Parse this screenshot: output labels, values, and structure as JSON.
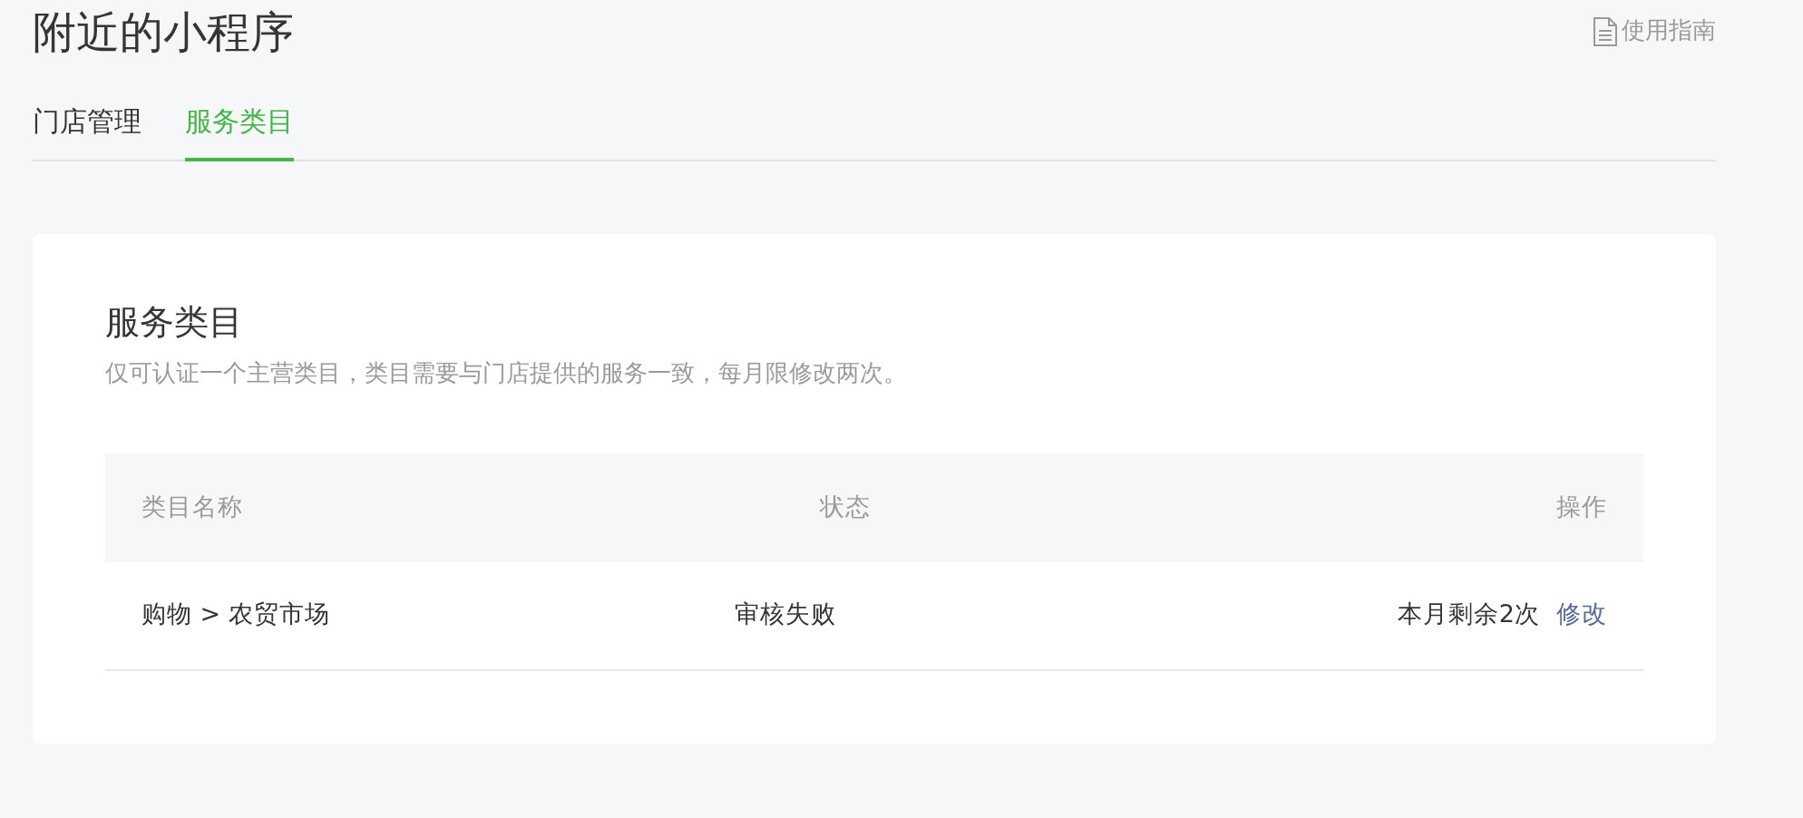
{
  "page": {
    "title": "附近的小程序",
    "help_link": "使用指南"
  },
  "tabs": [
    {
      "label": "门店管理",
      "selected": false
    },
    {
      "label": "服务类目",
      "selected": true
    }
  ],
  "section": {
    "title": "服务类目",
    "description": "仅可认证一个主营类目，类目需要与门店提供的服务一致，每月限修改两次。"
  },
  "table": {
    "columns": [
      "类目名称",
      "状态",
      "操作"
    ],
    "rows": [
      {
        "category": "购物 > 农贸市场",
        "status": "审核失败",
        "remaining": "本月剩余2次",
        "action": "修改"
      }
    ]
  }
}
